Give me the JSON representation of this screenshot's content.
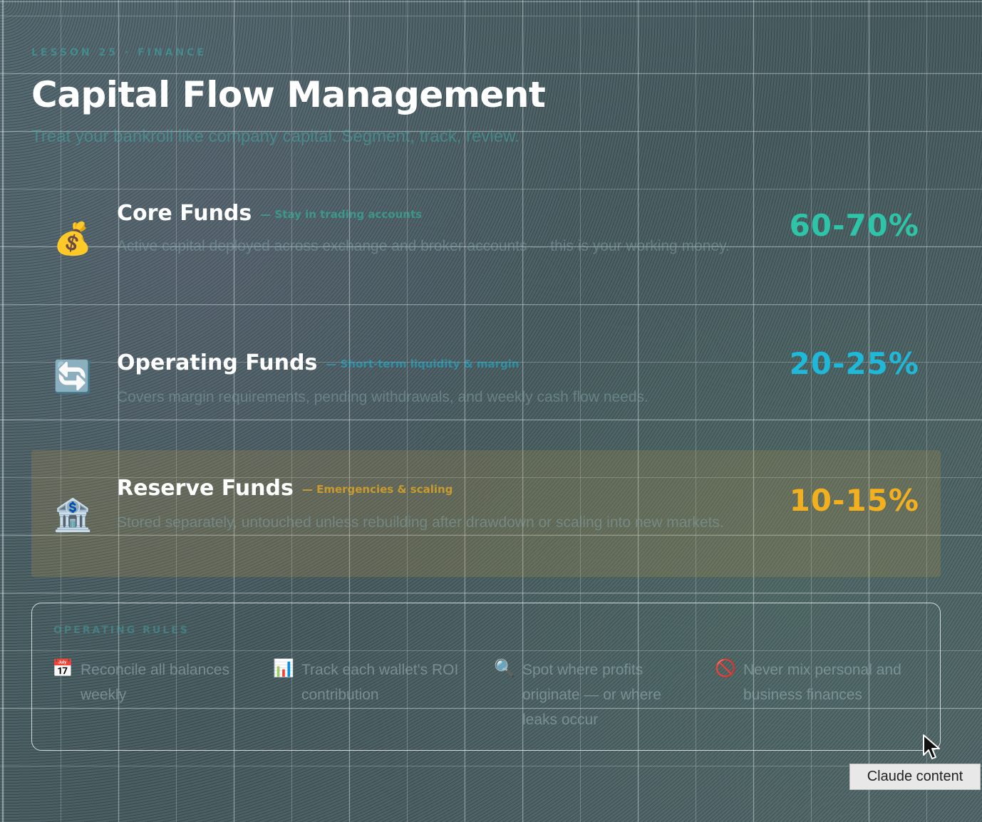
{
  "header": {
    "eyebrow": "LESSON 25 · FINANCE",
    "title": "Capital Flow Management",
    "subtitle": "Treat your bankroll like company capital. Segment, track, review."
  },
  "funds": [
    {
      "icon": "money-bag-icon",
      "title": "Core Funds",
      "tag": "— Stay in trading accounts",
      "description": "Active capital deployed across exchange and broker accounts — this is your working money.",
      "percent": "60-70%",
      "color": "#2ec4a8"
    },
    {
      "icon": "refresh-arrows-icon",
      "title": "Operating Funds",
      "tag": "— Short-term liquidity & margin",
      "description": "Covers margin requirements, pending withdrawals, and weekly cash flow needs.",
      "percent": "20-25%",
      "color": "#1fb8d8"
    },
    {
      "icon": "bank-icon",
      "title": "Reserve Funds",
      "tag": "— Emergencies & scaling",
      "description": "Stored separately, untouched unless rebuilding after drawdown or scaling into new markets.",
      "percent": "10-15%",
      "color": "#f2b01e"
    }
  ],
  "rules": {
    "title": "OPERATING RULES",
    "items": [
      {
        "icon": "calendar-icon",
        "text": "Reconcile all balances weekly"
      },
      {
        "icon": "bar-chart-icon",
        "text": "Track each wallet's ROI contribution"
      },
      {
        "icon": "magnifier-icon",
        "text": "Spot where profits originate — or where leaks occur"
      },
      {
        "icon": "prohibited-icon",
        "text": "Never mix personal and business finances"
      }
    ]
  },
  "tooltip": "Claude content"
}
